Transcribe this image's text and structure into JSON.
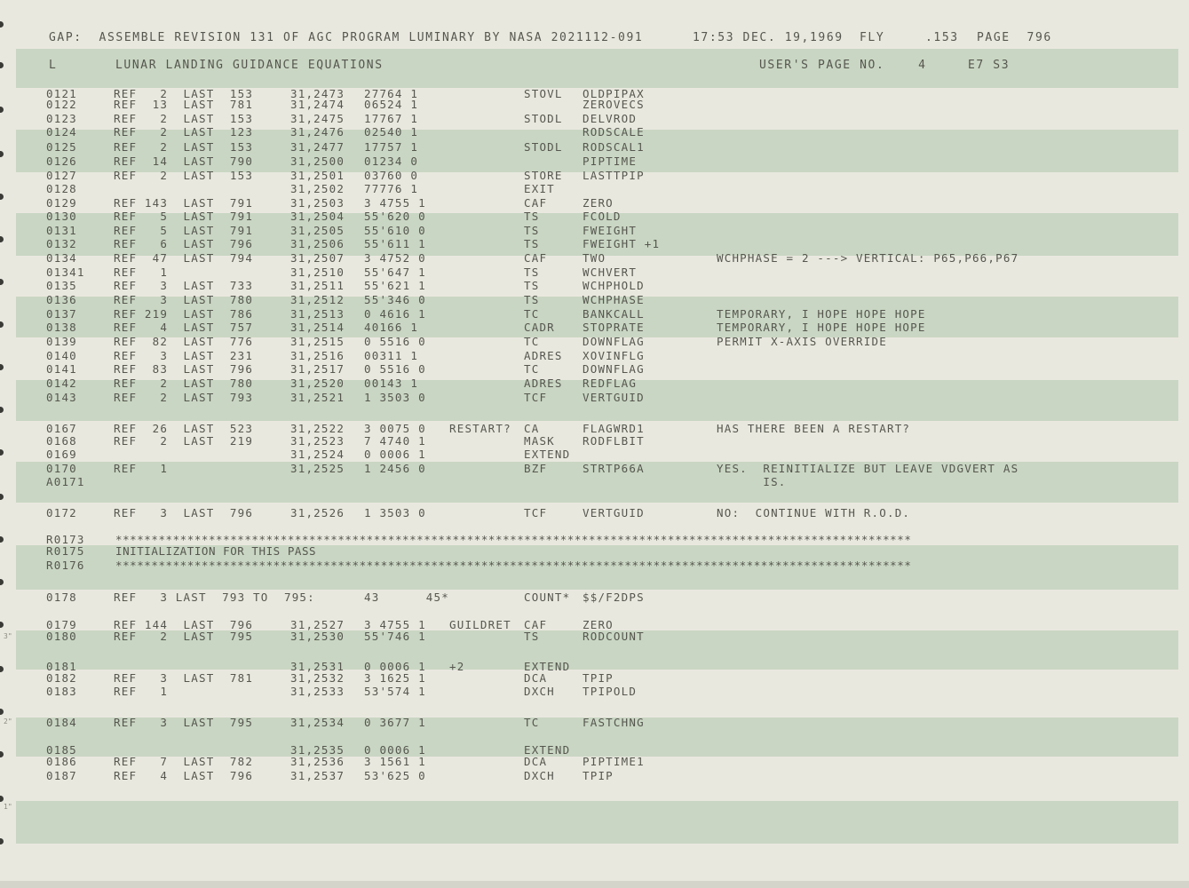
{
  "header": {
    "gap_line": "GAP:  ASSEMBLE REVISION 131 OF AGC PROGRAM LUMINARY BY NASA 2021112-091",
    "timestamp": "17:53 DEC. 19,1969",
    "mode": "FLY",
    "sheet": ".153",
    "page_label": "PAGE  796"
  },
  "subheader": {
    "letter": "L",
    "title": "LUNAR LANDING GUIDANCE EQUATIONS",
    "users_page": "USER'S PAGE NO.    4",
    "code": "E7 S3"
  },
  "rows": [
    {
      "line": "0121",
      "ref": "REF   2  LAST  153",
      "addr": "31,2473",
      "word": "27764 1",
      "label": "",
      "op": "STOVL",
      "operand": "OLDPIPAX",
      "comment": ""
    },
    {
      "line": "0122",
      "ref": "REF  13  LAST  781",
      "addr": "31,2474",
      "word": "06524 1",
      "label": "",
      "op": "",
      "operand": "ZEROVECS",
      "comment": ""
    },
    {
      "line": "0123",
      "ref": "REF   2  LAST  153",
      "addr": "31,2475",
      "word": "17767 1",
      "label": "",
      "op": "STODL",
      "operand": "DELVROD",
      "comment": ""
    },
    {
      "line": "0124",
      "ref": "REF   2  LAST  123",
      "addr": "31,2476",
      "word": "02540 1",
      "label": "",
      "op": "",
      "operand": "RODSCALE",
      "comment": ""
    },
    {
      "line": "0125",
      "ref": "REF   2  LAST  153",
      "addr": "31,2477",
      "word": "17757 1",
      "label": "",
      "op": "STODL",
      "operand": "RODSCAL1",
      "comment": ""
    },
    {
      "line": "0126",
      "ref": "REF  14  LAST  790",
      "addr": "31,2500",
      "word": "01234 0",
      "label": "",
      "op": "",
      "operand": "PIPTIME",
      "comment": ""
    },
    {
      "line": "0127",
      "ref": "REF   2  LAST  153",
      "addr": "31,2501",
      "word": "03760 0",
      "label": "",
      "op": "STORE",
      "operand": "LASTTPIP",
      "comment": ""
    },
    {
      "line": "0128",
      "ref": "",
      "addr": "31,2502",
      "word": "77776 1",
      "label": "",
      "op": "EXIT",
      "operand": "",
      "comment": ""
    },
    {
      "line": "0129",
      "ref": "REF 143  LAST  791",
      "addr": "31,2503",
      "word": "3 4755 1",
      "label": "",
      "op": "CAF",
      "operand": "ZERO",
      "comment": ""
    },
    {
      "line": "0130",
      "ref": "REF   5  LAST  791",
      "addr": "31,2504",
      "word": "55'620 0",
      "label": "",
      "op": "TS",
      "operand": "FCOLD",
      "comment": ""
    },
    {
      "line": "0131",
      "ref": "REF   5  LAST  791",
      "addr": "31,2505",
      "word": "55'610 0",
      "label": "",
      "op": "TS",
      "operand": "FWEIGHT",
      "comment": ""
    },
    {
      "line": "0132",
      "ref": "REF   6  LAST  796",
      "addr": "31,2506",
      "word": "55'611 1",
      "label": "",
      "op": "TS",
      "operand": "FWEIGHT +1",
      "comment": ""
    },
    {
      "line": "0134",
      "ref": "REF  47  LAST  794",
      "addr": "31,2507",
      "word": "3 4752 0",
      "label": "",
      "op": "CAF",
      "operand": "TWO",
      "comment": "WCHPHASE = 2 ---> VERTICAL: P65,P66,P67"
    },
    {
      "line": "01341",
      "ref": "REF   1",
      "addr": "31,2510",
      "word": "55'647 1",
      "label": "",
      "op": "TS",
      "operand": "WCHVERT",
      "comment": ""
    },
    {
      "line": "0135",
      "ref": "REF   3  LAST  733",
      "addr": "31,2511",
      "word": "55'621 1",
      "label": "",
      "op": "TS",
      "operand": "WCHPHOLD",
      "comment": ""
    },
    {
      "line": "0136",
      "ref": "REF   3  LAST  780",
      "addr": "31,2512",
      "word": "55'346 0",
      "label": "",
      "op": "TS",
      "operand": "WCHPHASE",
      "comment": ""
    },
    {
      "line": "0137",
      "ref": "REF 219  LAST  786",
      "addr": "31,2513",
      "word": "0 4616 1",
      "label": "",
      "op": "TC",
      "operand": "BANKCALL",
      "comment": "TEMPORARY, I HOPE HOPE HOPE"
    },
    {
      "line": "0138",
      "ref": "REF   4  LAST  757",
      "addr": "31,2514",
      "word": "40166 1",
      "label": "",
      "op": "CADR",
      "operand": "STOPRATE",
      "comment": "TEMPORARY, I HOPE HOPE HOPE"
    },
    {
      "line": "0139",
      "ref": "REF  82  LAST  776",
      "addr": "31,2515",
      "word": "0 5516 0",
      "label": "",
      "op": "TC",
      "operand": "DOWNFLAG",
      "comment": "PERMIT X-AXIS OVERRIDE"
    },
    {
      "line": "0140",
      "ref": "REF   3  LAST  231",
      "addr": "31,2516",
      "word": "00311 1",
      "label": "",
      "op": "ADRES",
      "operand": "XOVINFLG",
      "comment": ""
    },
    {
      "line": "0141",
      "ref": "REF  83  LAST  796",
      "addr": "31,2517",
      "word": "0 5516 0",
      "label": "",
      "op": "TC",
      "operand": "DOWNFLAG",
      "comment": ""
    },
    {
      "line": "0142",
      "ref": "REF   2  LAST  780",
      "addr": "31,2520",
      "word": "00143 1",
      "label": "",
      "op": "ADRES",
      "operand": "REDFLAG",
      "comment": ""
    },
    {
      "line": "0143",
      "ref": "REF   2  LAST  793",
      "addr": "31,2521",
      "word": "1 3503 0",
      "label": "",
      "op": "TCF",
      "operand": "VERTGUID",
      "comment": ""
    },
    {
      "line": "0167",
      "ref": "REF  26  LAST  523",
      "addr": "31,2522",
      "word": "3 0075 0",
      "label": "RESTART?",
      "op": "CA",
      "operand": "FLAGWRD1",
      "comment": "HAS THERE BEEN A RESTART?"
    },
    {
      "line": "0168",
      "ref": "REF   2  LAST  219",
      "addr": "31,2523",
      "word": "7 4740 1",
      "label": "",
      "op": "MASK",
      "operand": "RODFLBIT",
      "comment": ""
    },
    {
      "line": "0169",
      "ref": "",
      "addr": "31,2524",
      "word": "0 0006 1",
      "label": "",
      "op": "EXTEND",
      "operand": "",
      "comment": ""
    },
    {
      "line": "0170",
      "ref": "REF   1",
      "addr": "31,2525",
      "word": "1 2456 0",
      "label": "",
      "op": "BZF",
      "operand": "STRTP66A",
      "comment": "YES.  REINITIALIZE BUT LEAVE VDGVERT AS"
    },
    {
      "line": "A0171",
      "ref": "",
      "addr": "",
      "word": "",
      "label": "",
      "op": "",
      "operand": "",
      "comment": "      IS."
    },
    {
      "line": "0172",
      "ref": "REF   3  LAST  796",
      "addr": "31,2526",
      "word": "1 3503 0",
      "label": "",
      "op": "TCF",
      "operand": "VERTGUID",
      "comment": "NO:  CONTINUE WITH R.O.D."
    },
    {
      "line": "R0173",
      "ref": "",
      "addr": "",
      "word": "",
      "label": "",
      "op": "",
      "operand": "",
      "comment": "",
      "full": "***************************************************************************************************************"
    },
    {
      "line": "R0175",
      "ref": "",
      "addr": "",
      "word": "",
      "label": "",
      "op": "",
      "operand": "",
      "comment": "",
      "full": "INITIALIZATION FOR THIS PASS"
    },
    {
      "line": "R0176",
      "ref": "",
      "addr": "",
      "word": "",
      "label": "",
      "op": "",
      "operand": "",
      "comment": "",
      "full": "***************************************************************************************************************"
    },
    {
      "line": "0178",
      "ref": "REF   3 LAST  793 TO  795:",
      "addr": "",
      "word": "43      45*",
      "label": "",
      "op": "COUNT*",
      "operand": "$$/F2DPS",
      "comment": ""
    },
    {
      "line": "0179",
      "ref": "REF 144  LAST  796",
      "addr": "31,2527",
      "word": "3 4755 1",
      "label": "GUILDRET",
      "op": "CAF",
      "operand": "ZERO",
      "comment": ""
    },
    {
      "line": "0180",
      "ref": "REF   2  LAST  795",
      "addr": "31,2530",
      "word": "55'746 1",
      "label": "",
      "op": "TS",
      "operand": "RODCOUNT",
      "comment": ""
    },
    {
      "line": "0181",
      "ref": "",
      "addr": "31,2531",
      "word": "0 0006 1",
      "label": "+2",
      "op": "EXTEND",
      "operand": "",
      "comment": ""
    },
    {
      "line": "0182",
      "ref": "REF   3  LAST  781",
      "addr": "31,2532",
      "word": "3 1625 1",
      "label": "",
      "op": "DCA",
      "operand": "TPIP",
      "comment": ""
    },
    {
      "line": "0183",
      "ref": "REF   1",
      "addr": "31,2533",
      "word": "53'574 1",
      "label": "",
      "op": "DXCH",
      "operand": "TPIPOLD",
      "comment": ""
    },
    {
      "line": "0184",
      "ref": "REF   3  LAST  795",
      "addr": "31,2534",
      "word": "0 3677 1",
      "label": "",
      "op": "TC",
      "operand": "FASTCHNG",
      "comment": ""
    },
    {
      "line": "0185",
      "ref": "",
      "addr": "31,2535",
      "word": "0 0006 1",
      "label": "",
      "op": "EXTEND",
      "operand": "",
      "comment": ""
    },
    {
      "line": "0186",
      "ref": "REF   7  LAST  782",
      "addr": "31,2536",
      "word": "3 1561 1",
      "label": "",
      "op": "DCA",
      "operand": "PIPTIME1",
      "comment": ""
    },
    {
      "line": "0187",
      "ref": "REF   4  LAST  796",
      "addr": "31,2537",
      "word": "53'625 0",
      "label": "",
      "op": "DXCH",
      "operand": "TPIP",
      "comment": ""
    }
  ],
  "margin_marks": [
    "3\"",
    "2\"",
    "1\""
  ],
  "colors": {
    "paper": "#e9e8df",
    "band": "#c9d6c3",
    "ink": "#56574f"
  }
}
